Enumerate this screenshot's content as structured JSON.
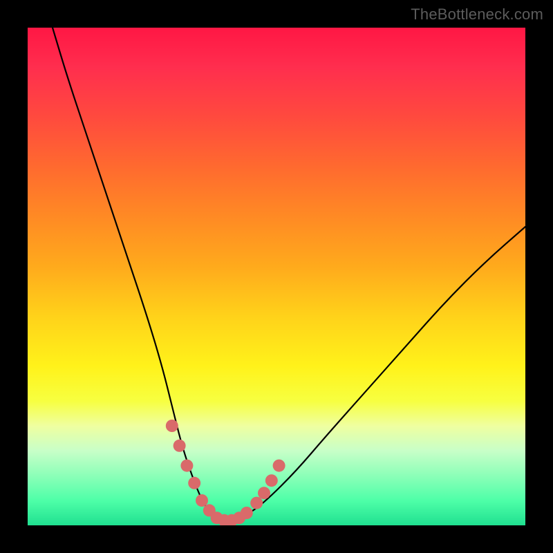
{
  "watermark": "TheBottleneck.com",
  "chart_data": {
    "type": "line",
    "title": "",
    "xlabel": "",
    "ylabel": "",
    "xlim": [
      0,
      100
    ],
    "ylim": [
      0,
      100
    ],
    "grid": false,
    "legend": false,
    "series": [
      {
        "name": "bottleneck-curve",
        "x": [
          5,
          8,
          12,
          16,
          20,
          24,
          27,
          29,
          31,
          33,
          35,
          37,
          39,
          41,
          44,
          48,
          54,
          60,
          68,
          76,
          84,
          92,
          100
        ],
        "y": [
          100,
          90,
          78,
          66,
          54,
          42,
          32,
          24,
          16,
          10,
          5,
          2,
          1,
          1,
          2,
          5,
          11,
          18,
          27,
          36,
          45,
          53,
          60
        ]
      }
    ],
    "highlight_dots": {
      "name": "marked-points",
      "x": [
        29,
        30.5,
        32,
        33.5,
        35,
        36.5,
        38,
        39.5,
        41,
        42.5,
        44,
        46,
        47.5,
        49,
        50.5
      ],
      "y": [
        20,
        16,
        12,
        8.5,
        5,
        3,
        1.5,
        1,
        1,
        1.5,
        2.5,
        4.5,
        6.5,
        9,
        12
      ],
      "color": "#d96a6a"
    }
  }
}
